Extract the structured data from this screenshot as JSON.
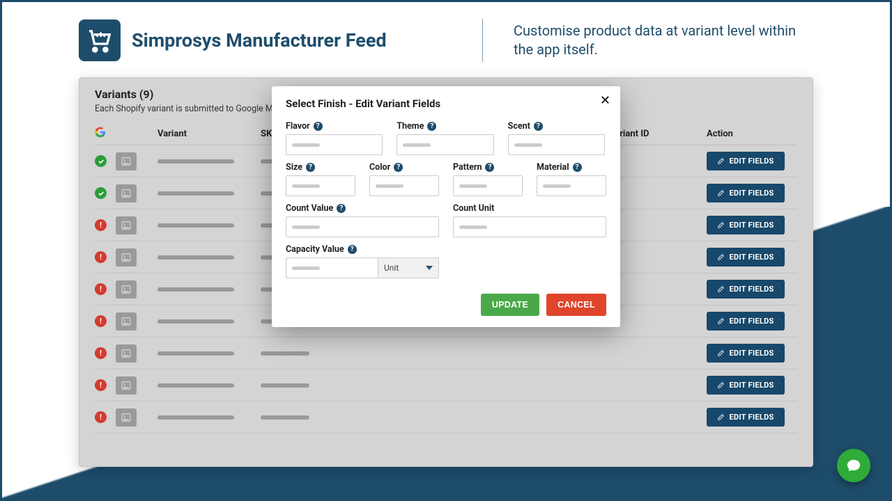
{
  "header": {
    "brand_title": "Simprosys Manufacturer Feed",
    "tagline": "Customise product data at variant level within the app itself."
  },
  "panel": {
    "title_prefix": "Variants",
    "variant_count": 9,
    "subtitle": "Each Shopify variant is submitted to Google Manufacturer Center as a separate item.",
    "columns": {
      "variant": "Variant",
      "sku": "SKU",
      "variant_id": "Variant ID",
      "action": "Action"
    },
    "edit_button_label": "EDIT FIELDS",
    "rows": [
      {
        "status": "ok"
      },
      {
        "status": "ok"
      },
      {
        "status": "error"
      },
      {
        "status": "error"
      },
      {
        "status": "error"
      },
      {
        "status": "error"
      },
      {
        "status": "error"
      },
      {
        "status": "error"
      },
      {
        "status": "error"
      }
    ]
  },
  "modal": {
    "title": "Select Finish - Edit Variant Fields",
    "fields": {
      "flavor": "Flavor",
      "theme": "Theme",
      "scent": "Scent",
      "size": "Size",
      "color": "Color",
      "pattern": "Pattern",
      "material": "Material",
      "count_value": "Count Value",
      "count_unit": "Count Unit",
      "capacity_value": "Capacity Value",
      "capacity_unit_label": "Unit"
    },
    "actions": {
      "update": "UPDATE",
      "cancel": "CANCEL"
    },
    "close_glyph": "✕"
  },
  "help_glyph": "?",
  "fab_name": "chat-bubble-icon"
}
